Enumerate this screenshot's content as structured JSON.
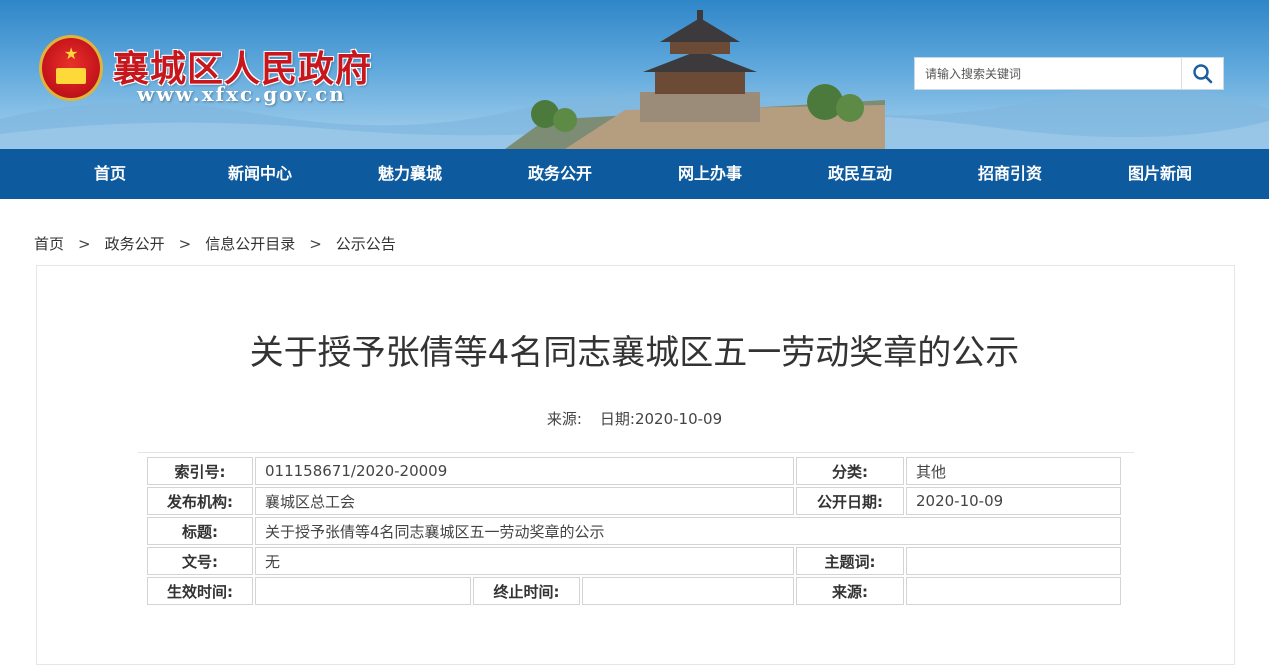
{
  "header": {
    "site_title": "襄城区人民政府",
    "site_url": "www.xfxc.gov.cn",
    "emblem_icon": "national-emblem-icon",
    "search": {
      "placeholder": "请输入搜索关键词",
      "button_icon": "search-icon"
    }
  },
  "nav": {
    "items": [
      {
        "label": "首页"
      },
      {
        "label": "新闻中心"
      },
      {
        "label": "魅力襄城"
      },
      {
        "label": "政务公开"
      },
      {
        "label": "网上办事"
      },
      {
        "label": "政民互动"
      },
      {
        "label": "招商引资"
      },
      {
        "label": "图片新闻"
      }
    ]
  },
  "breadcrumb": {
    "items": [
      "首页",
      "政务公开",
      "信息公开目录",
      "公示公告"
    ],
    "separator": ">"
  },
  "article": {
    "title": "关于授予张倩等4名同志襄城区五一劳动奖章的公示",
    "source_label": "来源:",
    "date_label": "日期:",
    "date_value": "2020-10-09"
  },
  "info": {
    "index_label": "索引号:",
    "index_value": "011158671/2020-20009",
    "category_label": "分类:",
    "category_value": "其他",
    "publisher_label": "发布机构:",
    "publisher_value": "襄城区总工会",
    "pubdate_label": "公开日期:",
    "pubdate_value": "2020-10-09",
    "title_label": "标题:",
    "title_value": "关于授予张倩等4名同志襄城区五一劳动奖章的公示",
    "docno_label": "文号:",
    "docno_value": "无",
    "keywords_label": "主题词:",
    "keywords_value": "",
    "effective_label": "生效时间:",
    "effective_value": "",
    "expire_label": "终止时间:",
    "expire_value": "",
    "source_label": "来源:",
    "source_value": ""
  },
  "colors": {
    "nav_bg": "#0e5a9e",
    "title_red": "#c8161d",
    "banner_sky": "#5fa8dc"
  }
}
